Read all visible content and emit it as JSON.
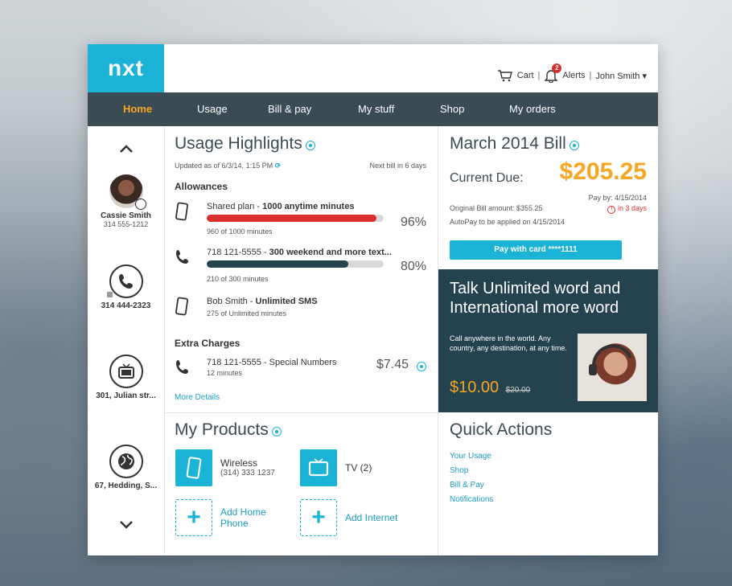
{
  "brand": {
    "logo": "nxt",
    "accent": "#1bb3d6",
    "nav_bg": "#3b4b53",
    "highlight": "#f5a623"
  },
  "header": {
    "cart": "Cart",
    "alerts": "Alerts",
    "alert_count": "2",
    "user": "John Smith ▾",
    "sep": "|"
  },
  "nav": {
    "tabs": [
      "Home",
      "Usage",
      "Bill & pay",
      "My stuff",
      "Shop",
      "My orders"
    ],
    "active": "Home"
  },
  "sidebar": {
    "contacts": [
      {
        "name": "Cassie Smith",
        "number": "314 555-1212",
        "icon": "avatar"
      },
      {
        "name": "314 444-2323",
        "number": "",
        "icon": "phone-icon"
      },
      {
        "name": "301, Julian str...",
        "number": "",
        "icon": "tv-icon"
      },
      {
        "name": "67, Hedding, S...",
        "number": "",
        "icon": "globe-icon"
      }
    ]
  },
  "usage": {
    "title": "Usage Highlights",
    "updated": "Updated as of 6/3/14, 1:15 PM",
    "next_bill": "Next bill in 6 days",
    "allowances_title": "Allowances",
    "items": [
      {
        "label_pre": "Shared plan - ",
        "label_bold": "1000 anytime minutes",
        "sub": "960 of 1000 minutes",
        "pct": "96%",
        "fill": 0.96,
        "color": "#d9302f"
      },
      {
        "label_pre": "718 121-5555 - ",
        "label_bold": "300 weekend and more text...",
        "sub": "210 of 300 minutes",
        "pct": "80%",
        "fill": 0.8,
        "color": "#25434f"
      },
      {
        "label_pre": "Bob Smith - ",
        "label_bold": "Unlimited SMS",
        "sub": "275 of Unlimited minutes"
      }
    ],
    "extra_title": "Extra Charges",
    "extra": {
      "label": "718 121-5555 - Special Numbers",
      "sub": "12 minutes",
      "amount": "$7.45"
    },
    "more": "More Details"
  },
  "bill": {
    "title": "March 2014 Bill",
    "current_due_label": "Current Due:",
    "amount": "$205.25",
    "pay_by": "Pay by: 4/15/2014",
    "original": "Original Bill amount: $355.25",
    "in_days": "in 3 days",
    "autopay": "AutoPay to be applied on 4/15/2014",
    "pay_button": "Pay with card ****1111"
  },
  "promo": {
    "title_line1": "Talk Unlimited word and",
    "title_line2": "International  more word",
    "desc": "Call anywhere in the world. Any country, any destination, at any time.",
    "price": "$10.00",
    "old_price": "$20.00"
  },
  "products": {
    "title": "My Products",
    "items": [
      {
        "label": "Wireless",
        "sub": "(314) 333 1237"
      },
      {
        "label": "TV (2)",
        "sub": ""
      },
      {
        "label": "Add Home Phone",
        "sub": ""
      },
      {
        "label": "Add Internet",
        "sub": ""
      }
    ]
  },
  "quick": {
    "title": "Quick Actions",
    "links": [
      "Your Usage",
      "Shop",
      "Bill & Pay",
      "Notifications"
    ]
  }
}
